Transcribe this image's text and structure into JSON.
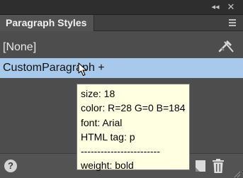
{
  "titlebar": {
    "collapse_glyph": "◂◂",
    "close_glyph": "✕"
  },
  "panel": {
    "tab_title": "Paragraph Styles"
  },
  "styles_list": {
    "items": [
      {
        "label": "[None]",
        "selected": false
      },
      {
        "label": "CustomParagraph +",
        "selected": true
      }
    ]
  },
  "tooltip": {
    "lines": [
      "size: 18",
      "color: R=28 G=0 B=184",
      "font: Arial",
      "HTML tag: p",
      "------------------------",
      "weight: bold"
    ]
  },
  "footer": {
    "help_glyph": "?"
  },
  "icons": {
    "clear_overrides": "clear-overrides-icon",
    "new_style": "new-style-icon",
    "delete": "trash-icon",
    "help": "help-icon",
    "panel_menu": "hamburger-menu-icon",
    "cursor": "mouse-pointer-icon"
  },
  "colors": {
    "panel_bg": "#535353",
    "selection_bg": "#a7c9ec",
    "tooltip_bg": "#ffffe1"
  }
}
